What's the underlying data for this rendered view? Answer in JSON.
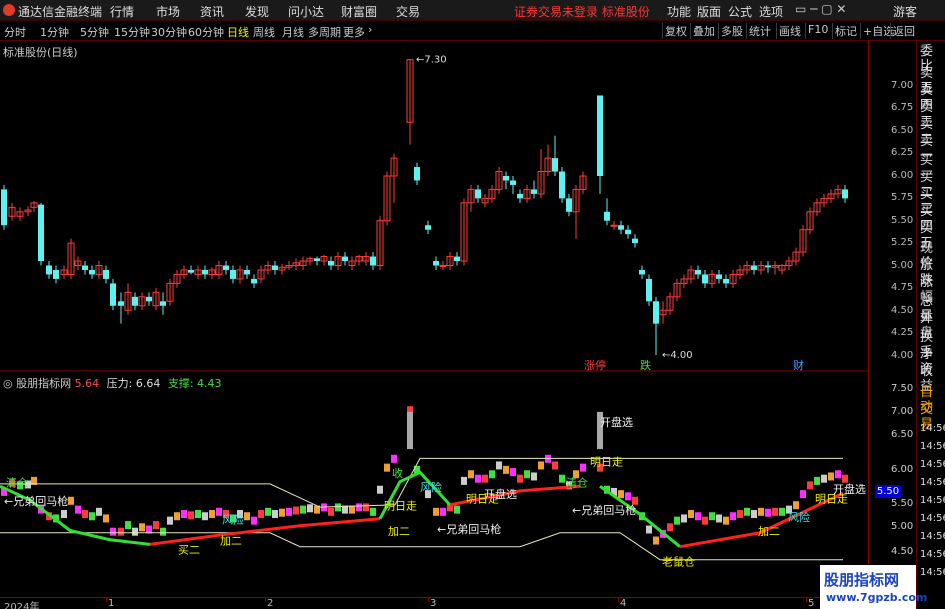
{
  "menubar": {
    "app_name": "通达信金融终端",
    "items": [
      "行情",
      "市场",
      "资讯",
      "发现",
      "问小达",
      "财富圈",
      "交易"
    ],
    "notice": "证券交易未登录  标准股份",
    "right_items": [
      "功能",
      "版面",
      "公式",
      "选项"
    ],
    "guest": "游客"
  },
  "periodbar": {
    "periods": [
      "分时",
      "1分钟",
      "5分钟",
      "15分钟",
      "30分钟",
      "60分钟",
      "日线",
      "周线",
      "月线",
      "多周期",
      "更多"
    ],
    "active_period": "日线",
    "tools": [
      "复权",
      "叠加",
      "多股",
      "统计",
      "画线",
      "F10",
      "标记",
      "+自选",
      "返回"
    ]
  },
  "main_chart": {
    "title": "标准股份(日线)",
    "price_ticks": [
      "7.00",
      "6.75",
      "6.50",
      "6.25",
      "6.00",
      "5.75",
      "5.50",
      "5.25",
      "5.00",
      "4.75",
      "4.50",
      "4.25",
      "4.00"
    ],
    "high_label": "7.30",
    "low_label": "4.00",
    "markers": [
      "涨停",
      "跌",
      "财"
    ]
  },
  "indicator": {
    "name": "股朋指标网",
    "value": "5.64",
    "pressure_label": "压力:",
    "pressure": "6.64",
    "support_label": "支撑:",
    "support": "4.43",
    "ticks": [
      "7.50",
      "7.00",
      "6.50",
      "6.00",
      "5.50",
      "5.00",
      "4.50"
    ],
    "current_value": "5.50",
    "signals": [
      "清仓",
      "←兄弟回马枪",
      "风险",
      "买二",
      "加二",
      "收",
      "风险",
      "明日走",
      "加二",
      "←兄弟回马枪",
      "开盘选",
      "明日走",
      "清仓",
      "开盘选",
      "明日走",
      "←兄弟回马枪",
      "老鼠仓",
      "加二",
      "风险",
      "开盘选",
      "明日走"
    ]
  },
  "right_panel": [
    "委比",
    "卖五",
    "卖四",
    "卖三",
    "卖二",
    "卖一",
    "买一",
    "买二",
    "买三",
    "买四",
    "买五",
    "现价",
    "涨跌",
    "涨幅",
    "总量",
    "外盘",
    "换手",
    "净资",
    "收益",
    "自动",
    "交易",
    "14:56",
    "14:56",
    "14:56",
    "14:56",
    "14:56",
    "14:56",
    "14:56",
    "14:56",
    "14:56"
  ],
  "date_axis": [
    "2024年",
    "1",
    "2",
    "3",
    "4",
    "5"
  ],
  "watermark": {
    "title": "股朋指标网",
    "url": "www.7gpzb.com"
  },
  "colors": {
    "up": "#ff3a3a",
    "down": "#5ff0f0",
    "background": "#000000",
    "axis": "#8a0000"
  }
}
